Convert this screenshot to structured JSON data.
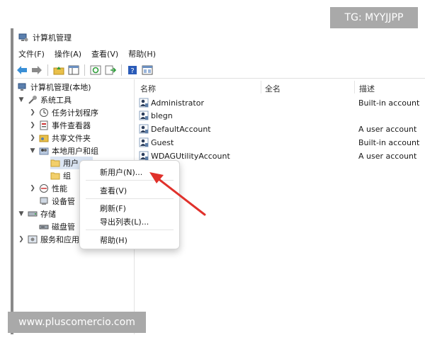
{
  "window": {
    "title": "计算机管理"
  },
  "menu": [
    "文件(F)",
    "操作(A)",
    "查看(V)",
    "帮助(H)"
  ],
  "toolbar": {
    "icons": [
      "back-arrow-icon",
      "forward-arrow-icon",
      "folder-up-icon",
      "show-hide-tree-icon",
      "refresh-icon",
      "export-list-icon",
      "help-icon",
      "console-view-icon"
    ]
  },
  "tree": {
    "root": "计算机管理(本地)",
    "system_tools": "系统工具",
    "task_scheduler": "任务计划程序",
    "event_viewer": "事件查看器",
    "shared_folders": "共享文件夹",
    "local_users_groups": "本地用户和组",
    "users": "用户",
    "groups": "组",
    "performance": "性能",
    "device_manager": "设备管",
    "storage": "存储",
    "disk_management": "磁盘管",
    "services_apps": "服务和应用"
  },
  "table": {
    "columns": [
      "名称",
      "全名",
      "描述"
    ],
    "rows": [
      {
        "name": "Administrator",
        "fullname": "",
        "desc": "Built-in account"
      },
      {
        "name": "blegn",
        "fullname": "",
        "desc": ""
      },
      {
        "name": "DefaultAccount",
        "fullname": "",
        "desc": "A user account"
      },
      {
        "name": "Guest",
        "fullname": "",
        "desc": "Built-in account"
      },
      {
        "name": "WDAGUtilityAccount",
        "fullname": "",
        "desc": "A user account"
      }
    ]
  },
  "context_menu": {
    "new_user": "新用户(N)...",
    "view": "查看(V)",
    "refresh": "刷新(F)",
    "export_list": "导出列表(L)...",
    "help": "帮助(H)"
  },
  "annotation": {
    "arrow_color": "#e0312b"
  },
  "watermarks": {
    "top": "TG: MYYJJPP",
    "bottom": "www.pluscomercio.com"
  }
}
